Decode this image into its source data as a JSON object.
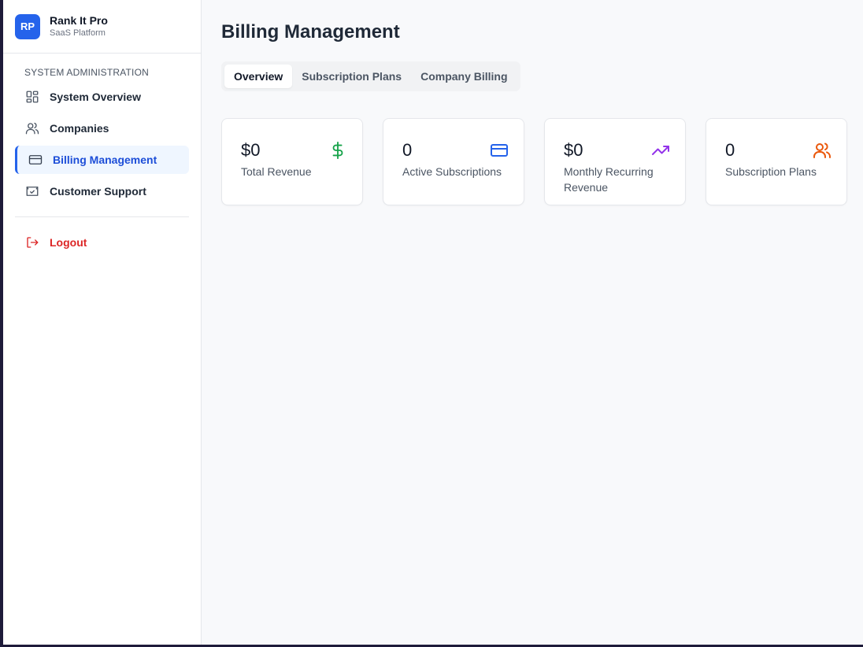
{
  "app": {
    "logo_text": "RP",
    "name": "Rank It Pro",
    "subtitle": "SaaS Platform"
  },
  "sidebar": {
    "section_label": "SYSTEM ADMINISTRATION",
    "items": [
      {
        "label": "System Overview",
        "icon": "grid-icon"
      },
      {
        "label": "Companies",
        "icon": "users-icon"
      },
      {
        "label": "Billing Management",
        "icon": "credit-card-icon",
        "active": true
      },
      {
        "label": "Customer Support",
        "icon": "support-ticket-icon"
      }
    ],
    "logout_label": "Logout"
  },
  "main": {
    "title": "Billing Management",
    "tabs": [
      {
        "label": "Overview",
        "active": true
      },
      {
        "label": "Subscription Plans"
      },
      {
        "label": "Company Billing"
      }
    ],
    "stats": [
      {
        "value": "$0",
        "label": "Total Revenue",
        "icon": "dollar-icon",
        "color": "#16a34a"
      },
      {
        "value": "0",
        "label": "Active Subscriptions",
        "icon": "credit-card-icon",
        "color": "#2563eb"
      },
      {
        "value": "$0",
        "label": "Monthly Recurring Revenue",
        "icon": "trending-up-icon",
        "color": "#9333ea"
      },
      {
        "value": "0",
        "label": "Subscription Plans",
        "icon": "users-icon",
        "color": "#ea580c"
      }
    ]
  }
}
